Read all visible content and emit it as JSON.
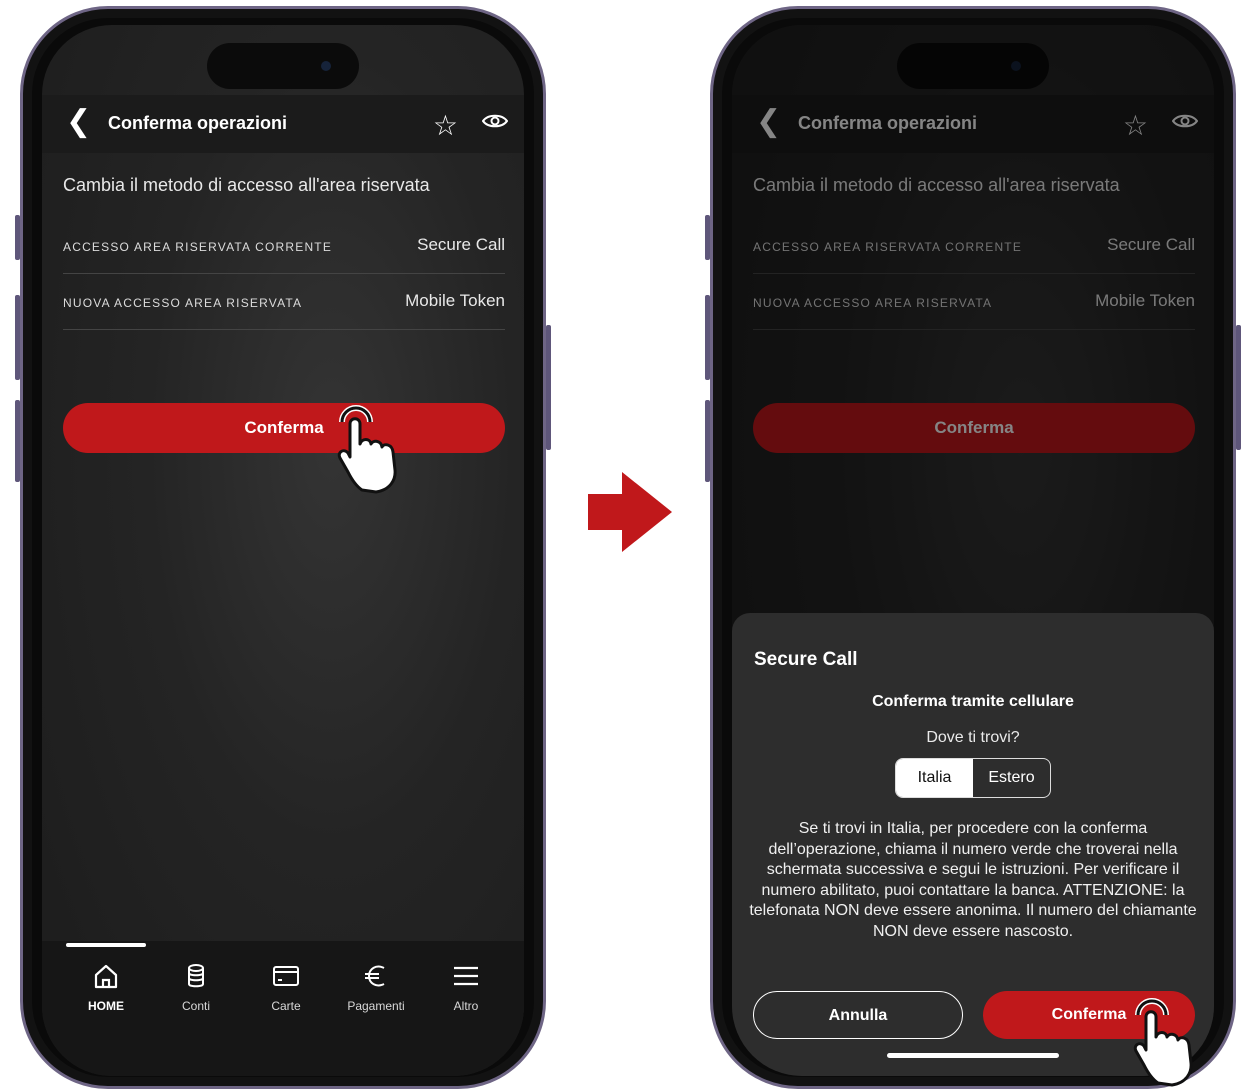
{
  "colors": {
    "accent": "#c0181b",
    "bg": "#242424",
    "sheet": "#2d2d2d"
  },
  "left_phone": {
    "header": {
      "title": "Conferma operazioni",
      "back_icon": "chevron-left-icon",
      "star_icon": "star-icon",
      "eye_icon": "eye-icon"
    },
    "description": "Cambia il metodo di accesso all'area riservata",
    "rows": [
      {
        "label": "ACCESSO AREA RISERVATA CORRENTE",
        "value": "Secure Call"
      },
      {
        "label": "NUOVA ACCESSO AREA RISERVATA",
        "value": "Mobile Token"
      }
    ],
    "confirm_label": "Conferma",
    "nav": [
      {
        "label": "HOME",
        "icon": "home-icon",
        "active": true
      },
      {
        "label": "Conti",
        "icon": "database-icon",
        "active": false
      },
      {
        "label": "Carte",
        "icon": "card-icon",
        "active": false
      },
      {
        "label": "Pagamenti",
        "icon": "euro-icon",
        "active": false
      },
      {
        "label": "Altro",
        "icon": "menu-icon",
        "active": false
      }
    ]
  },
  "right_phone": {
    "header": {
      "title": "Conferma operazioni"
    },
    "description": "Cambia il metodo di accesso all'area riservata",
    "rows": [
      {
        "label": "ACCESSO AREA RISERVATA CORRENTE",
        "value": "Secure Call"
      },
      {
        "label": "NUOVA ACCESSO AREA RISERVATA",
        "value": "Mobile Token"
      }
    ],
    "confirm_label": "Conferma",
    "sheet": {
      "title": "Secure Call",
      "subtitle": "Conferma tramite cellulare",
      "question": "Dove ti trovi?",
      "options": [
        "Italia",
        "Estero"
      ],
      "selected": "Italia",
      "body": "Se ti trovi in Italia, per procedere con la conferma dell’operazione, chiama il numero verde che troverai nella schermata successiva e segui le istruzioni. Per verificare il numero abilitato, puoi contattare la banca. ATTENZIONE: la telefonata NON deve essere anonima. Il numero del chiamante NON deve essere nascosto.",
      "cancel_label": "Annulla",
      "confirm_label": "Conferma"
    }
  }
}
